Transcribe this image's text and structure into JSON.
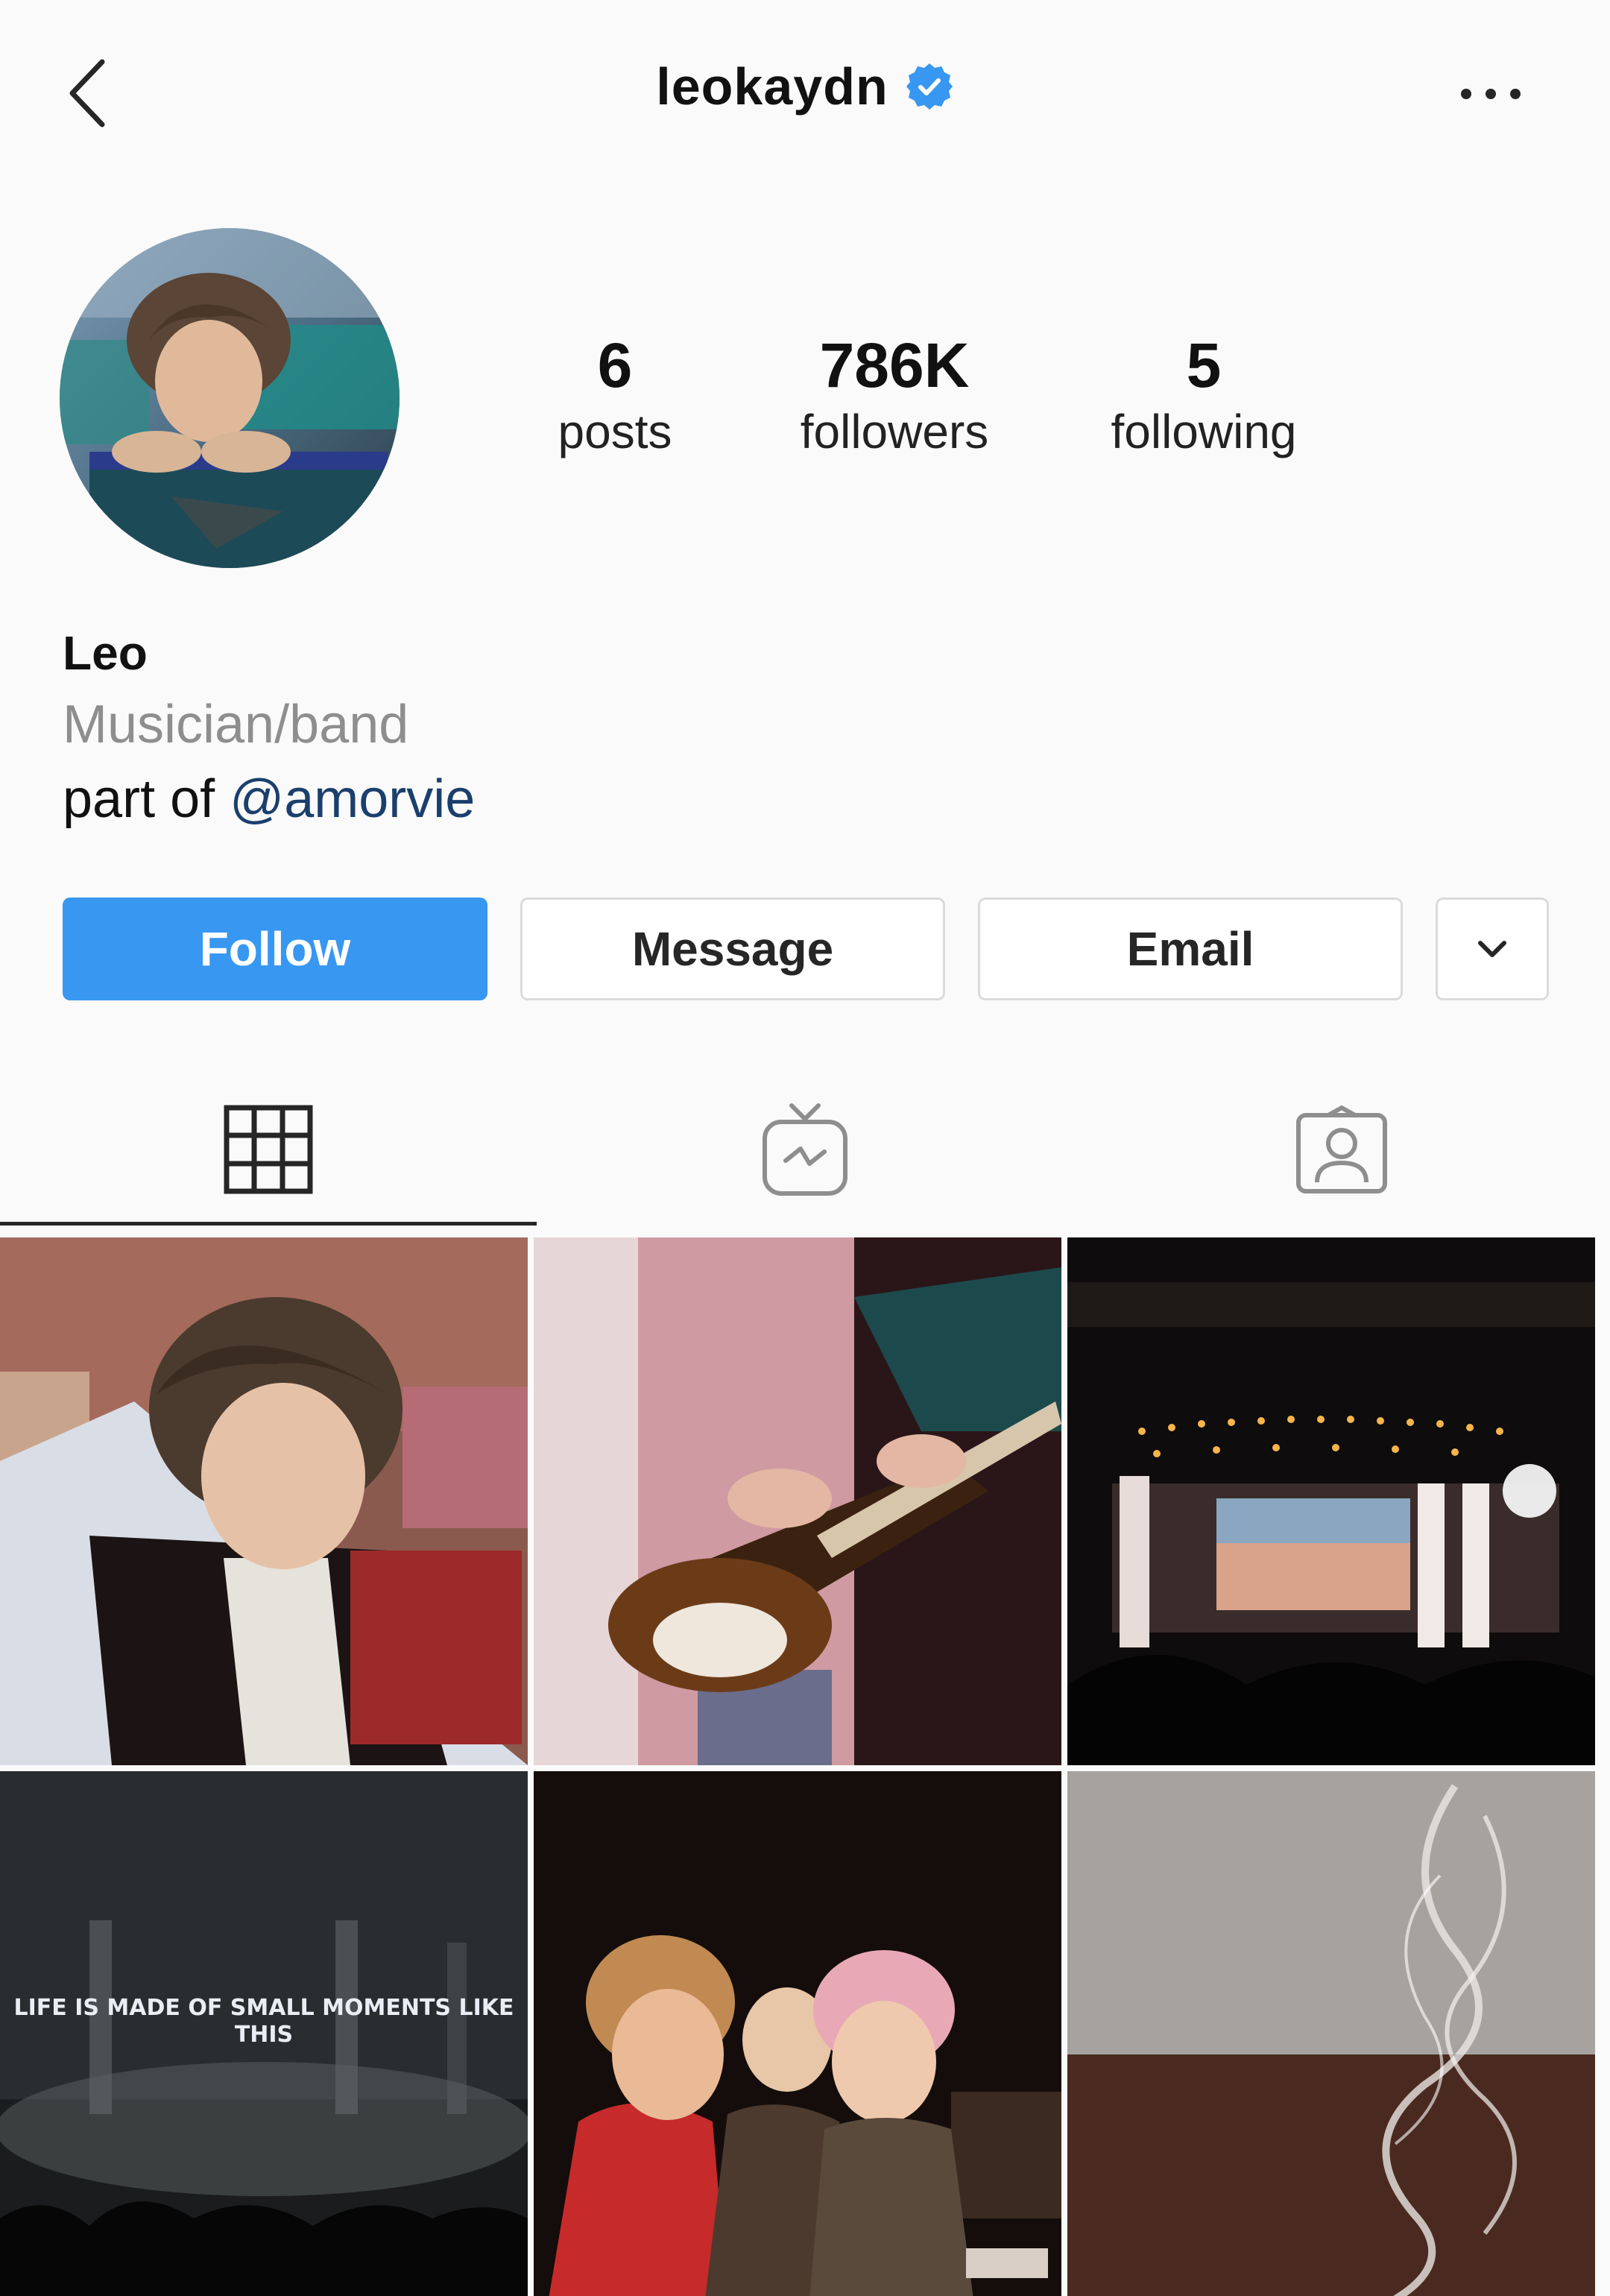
{
  "header": {
    "username": "leokaydn",
    "back_icon": "chevron-left-icon",
    "verified_icon": "verified-badge-icon",
    "more_icon": "more-horizontal-icon"
  },
  "stats": [
    {
      "value": "6",
      "label": "posts"
    },
    {
      "value": "786K",
      "label": "followers"
    },
    {
      "value": "5",
      "label": "following"
    }
  ],
  "bio": {
    "name": "Leo",
    "category": "Musician/band",
    "text_prefix": "part of ",
    "mention": "@amorvie"
  },
  "buttons": {
    "follow": "Follow",
    "message": "Message",
    "email": "Email",
    "more_icon": "chevron-down-icon"
  },
  "tabs": [
    {
      "name": "posts-grid",
      "icon": "grid-icon",
      "active": true
    },
    {
      "name": "igtv",
      "icon": "igtv-icon",
      "active": false
    },
    {
      "name": "tagged",
      "icon": "tagged-person-icon",
      "active": false
    }
  ],
  "posts": [
    {
      "id": 1,
      "description": "person in jacket"
    },
    {
      "id": 2,
      "description": "guitar"
    },
    {
      "id": 3,
      "description": "concert stage"
    },
    {
      "id": 4,
      "caption": "Life is made of small moments like this"
    },
    {
      "id": 5,
      "description": "three people"
    },
    {
      "id": 6,
      "description": "smoke"
    }
  ],
  "colors": {
    "accent": "#3897f0",
    "verified": "#3897f0",
    "mention": "#1b3f6d",
    "muted": "#8e8e8e",
    "background": "#fafafa"
  }
}
